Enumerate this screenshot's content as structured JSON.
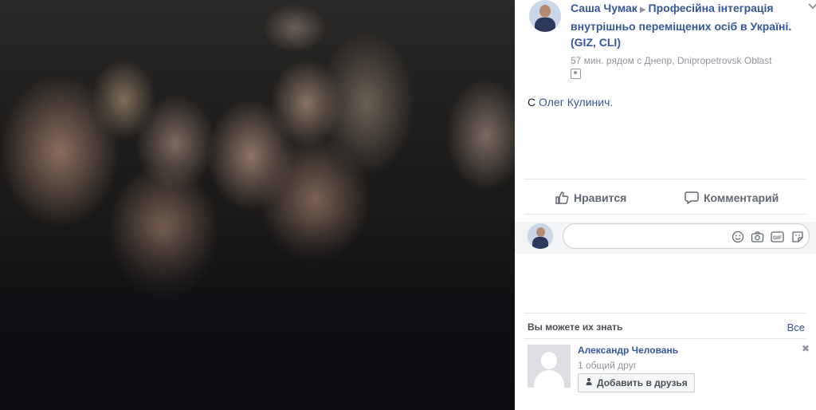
{
  "post": {
    "author": "Саша Чумак",
    "arrow": "▶",
    "target": "Професійна інтеграція внутрішньо переміщених осіб в Україні. (GIZ, CLI)",
    "meta": "57 мин. рядом с Днепр, Dnipropetrovsk Oblast",
    "with_prefix": "С",
    "with_person": "Олег Кулинич."
  },
  "actions": {
    "like_label": "Нравится",
    "comment_label": "Комментарий"
  },
  "comment_box": {
    "placeholder": ""
  },
  "pymk": {
    "heading": "Вы можете их знать",
    "see_all": "Все",
    "person": {
      "name": "Александр Человань",
      "mutual": "1 общий друг",
      "add_label": "Добавить в друзья"
    }
  },
  "colors": {
    "link": "#365899",
    "secondary_text": "#90949c",
    "panel_bg": "#ffffff"
  }
}
